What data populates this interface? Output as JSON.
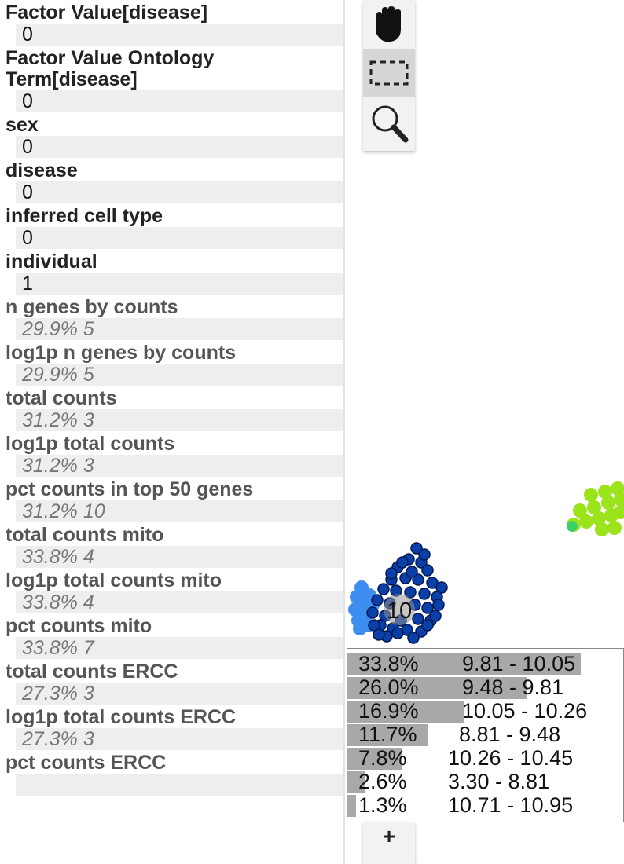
{
  "attributes": [
    {
      "name": "Factor Value[disease]",
      "value": "0",
      "kind": "plain"
    },
    {
      "name": "Factor Value Ontology Term[disease]",
      "value": "0",
      "kind": "plain"
    },
    {
      "name": "sex",
      "value": "0",
      "kind": "plain"
    },
    {
      "name": "disease",
      "value": "0",
      "kind": "plain"
    },
    {
      "name": "inferred cell type",
      "value": "0",
      "kind": "plain"
    },
    {
      "name": "individual",
      "value": "1",
      "kind": "plain"
    },
    {
      "name": "n genes by counts",
      "value": "29.9% 5",
      "kind": "stat"
    },
    {
      "name": "log1p n genes by counts",
      "value": "29.9% 5",
      "kind": "stat"
    },
    {
      "name": "total counts",
      "value": "31.2% 3",
      "kind": "stat"
    },
    {
      "name": "log1p total counts",
      "value": "31.2% 3",
      "kind": "stat"
    },
    {
      "name": "pct counts in top 50 genes",
      "value": "31.2% 10",
      "kind": "stat"
    },
    {
      "name": "total counts mito",
      "value": "33.8% 4",
      "kind": "stat"
    },
    {
      "name": "log1p total counts mito",
      "value": "33.8% 4",
      "kind": "stat"
    },
    {
      "name": "pct counts mito",
      "value": "33.8% 7",
      "kind": "stat"
    },
    {
      "name": "total counts ERCC",
      "value": "27.3% 3",
      "kind": "stat"
    },
    {
      "name": "log1p total counts ERCC",
      "value": "27.3% 3",
      "kind": "stat"
    },
    {
      "name": "pct counts ERCC",
      "value": "",
      "kind": "stat"
    }
  ],
  "toolbar": {
    "tools": [
      {
        "name": "pan-tool",
        "icon": "hand-icon",
        "active": false
      },
      {
        "name": "select-tool",
        "icon": "dashed-rectangle-icon",
        "active": true
      },
      {
        "name": "zoom-tool",
        "icon": "magnifier-icon",
        "active": false
      }
    ],
    "zoom_in_label": "+"
  },
  "cluster": {
    "label": "10",
    "colors": {
      "primary": "#0a3fa8",
      "secondary": "#3d8ef0",
      "neighbor": "#9be31a",
      "neighbor_edge": "#3ccf6a"
    }
  },
  "legend": {
    "rows": [
      {
        "percent": "33.8%",
        "range": "9.81 - 10.05",
        "fraction": 0.338
      },
      {
        "percent": "26.0%",
        "range": "9.48 - 9.81",
        "fraction": 0.26
      },
      {
        "percent": "16.9%",
        "range": "10.05 - 10.26",
        "fraction": 0.169
      },
      {
        "percent": "11.7%",
        "range": "8.81 - 9.48",
        "fraction": 0.117
      },
      {
        "percent": "7.8%",
        "range": "10.26 - 10.45",
        "fraction": 0.078
      },
      {
        "percent": "2.6%",
        "range": "3.30 - 8.81",
        "fraction": 0.026
      },
      {
        "percent": "1.3%",
        "range": "10.71 - 10.95",
        "fraction": 0.013
      }
    ]
  }
}
